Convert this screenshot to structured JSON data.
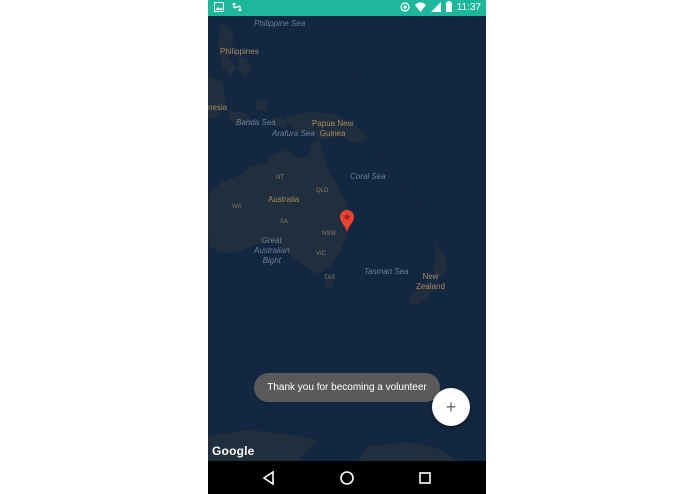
{
  "statusbar": {
    "time": "11:37",
    "left_icons": [
      "image-icon",
      "sync-icon"
    ],
    "right_icons": [
      "location-icon",
      "wifi-icon",
      "signal-icon",
      "battery-icon"
    ],
    "color": "#1fb79c"
  },
  "map": {
    "labels": {
      "philippine_sea": "Philippine Sea",
      "philippines": "Philippines",
      "indonesia_partial": "nesia",
      "banda_sea": "Banda Sea",
      "arafura_sea": "Arafura Sea",
      "papua_new_guinea": "Papua New\nGuinea",
      "coral_sea": "Coral Sea",
      "nt": "NT",
      "qld": "QLD",
      "australia": "Australia",
      "wa": "WA",
      "sa": "SA",
      "nsw": "NSW",
      "great_australian_bight": "Great\nAustralian\nBight",
      "vic": "VIC",
      "tasman_sea": "Tasman Sea",
      "new_zealand": "New\nZealand",
      "tas": "TAS"
    },
    "attribution": "Google",
    "marker_color": "#ea4335"
  },
  "toast": {
    "text": "Thank you for becoming a volunteer"
  },
  "fab": {
    "label": "+"
  },
  "navbar": {
    "icons": [
      "back-icon",
      "home-icon",
      "recents-icon"
    ]
  }
}
